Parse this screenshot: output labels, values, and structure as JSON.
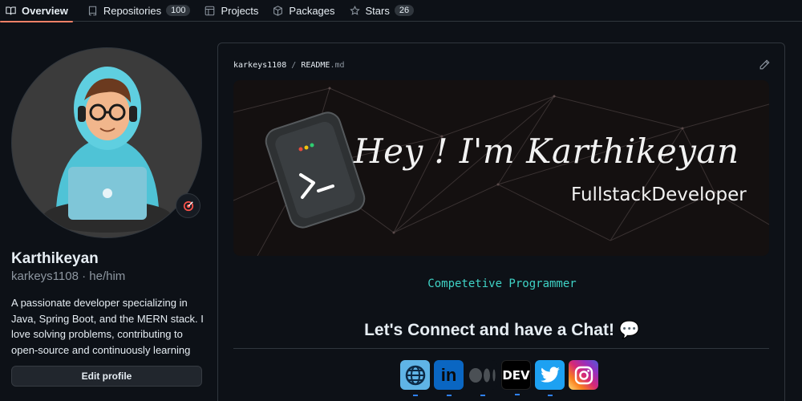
{
  "nav": {
    "tabs": [
      {
        "label": "Overview",
        "icon": "book-icon",
        "active": true
      },
      {
        "label": "Repositories",
        "icon": "repo-icon",
        "count": "100"
      },
      {
        "label": "Projects",
        "icon": "table-icon"
      },
      {
        "label": "Packages",
        "icon": "package-icon"
      },
      {
        "label": "Stars",
        "icon": "star-icon",
        "count": "26"
      }
    ]
  },
  "profile": {
    "name": "Karthikeyan",
    "handle": "karkeys1108 · he/him",
    "bio": "A passionate developer specializing in Java, Spring Boot, and the MERN stack. I love solving problems, contributing to open-source and continuously learning",
    "edit_label": "Edit profile",
    "status_icon": "target-icon"
  },
  "readme": {
    "owner": "karkeys1108",
    "separator": "/",
    "file_base": "README",
    "file_ext": ".md",
    "banner": {
      "heading": "Hey ! I'm Karthikeyan",
      "role": "FullstackDeveloper"
    },
    "tagline": "Competetive Programmer",
    "connect": "Let's Connect and have a Chat! 💬",
    "socials": [
      "globe-icon",
      "linkedin-icon",
      "medium-icon",
      "dev-icon",
      "twitter-icon",
      "instagram-icon"
    ],
    "social_text": {
      "linkedin": "in",
      "dev": "DEV"
    }
  },
  "colors": {
    "accent": "#f78166",
    "teal": "#3fd3c6",
    "bg": "#0d1117",
    "border": "#30363d"
  }
}
